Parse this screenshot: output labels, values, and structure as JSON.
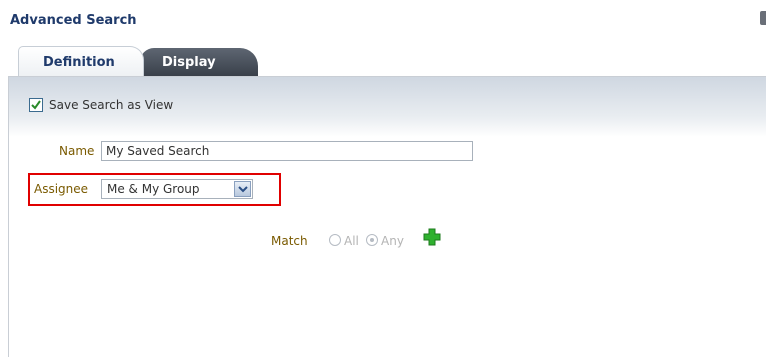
{
  "dialog": {
    "title": "Advanced Search",
    "tabs": [
      {
        "label": "Definition",
        "active": true
      },
      {
        "label": "Display",
        "active": false
      }
    ]
  },
  "form": {
    "save_view": {
      "label": "Save Search as View",
      "checked": true
    },
    "name": {
      "label": "Name",
      "value": "My Saved Search"
    },
    "assignee": {
      "label": "Assignee",
      "value": "Me & My Group"
    },
    "match": {
      "label": "Match",
      "options": [
        {
          "label": "All",
          "selected": false
        },
        {
          "label": "Any",
          "selected": true
        }
      ]
    }
  },
  "colors": {
    "title": "#1f3a6b",
    "label": "#7a5a00",
    "highlight": "#e00000",
    "add_icon": "#2fb12f"
  },
  "icons": {
    "close": "close-icon",
    "checkbox": "checkbox-checked-icon",
    "dropdown": "chevron-down-icon",
    "add": "plus-icon"
  }
}
